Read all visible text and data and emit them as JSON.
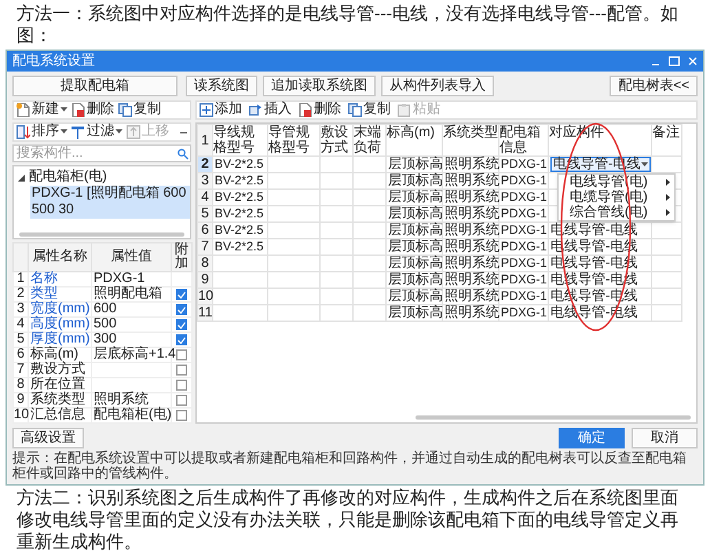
{
  "intro_text": "方法一：系统图中对应构件选择的是电线导管---电线，没有选择电线导管---配管。如图：",
  "dialog": {
    "title": "配电系统设置",
    "top_buttons": [
      "提取配电箱",
      "读系统图",
      "追加读取系统图",
      "从构件列表导入"
    ],
    "tree_table_button": "配电树表<<",
    "left_toolbar_1": [
      {
        "kind": "new",
        "label": "新建",
        "dropdown": true
      },
      {
        "kind": "delete",
        "label": "删除",
        "dropdown": false
      },
      {
        "kind": "copy",
        "label": "复制",
        "dropdown": false
      }
    ],
    "left_toolbar_2": [
      {
        "kind": "sort",
        "label": "排序",
        "dropdown": true,
        "disabled": false
      },
      {
        "kind": "filter",
        "label": "过滤",
        "dropdown": true,
        "disabled": false
      },
      {
        "kind": "up",
        "label": "上移",
        "dropdown": false,
        "disabled": true
      }
    ],
    "search": {
      "placeholder": "搜索构件..."
    },
    "tree": [
      {
        "label": "配电箱柜(电)",
        "expanded": true,
        "selected": false,
        "children": [
          {
            "label": "PDXG-1 [照明配电箱 600 500 30",
            "selected": true
          }
        ]
      }
    ],
    "properties": {
      "columns": [
        "属性名称",
        "属性值",
        "附加"
      ],
      "rows": [
        {
          "no": "1",
          "name": "名称",
          "value": "PDXG-1",
          "required": true
        },
        {
          "no": "2",
          "name": "类型",
          "value": "照明配电箱",
          "required": true,
          "checked": true
        },
        {
          "no": "3",
          "name": "宽度(mm)",
          "value": "600",
          "required": true,
          "checked": true
        },
        {
          "no": "4",
          "name": "高度(mm)",
          "value": "500",
          "required": true,
          "checked": true
        },
        {
          "no": "5",
          "name": "厚度(mm)",
          "value": "300",
          "required": true,
          "checked": true
        },
        {
          "no": "6",
          "name": "标高(m)",
          "value": "层底标高+1.4",
          "required": false,
          "checked": false
        },
        {
          "no": "7",
          "name": "敷设方式",
          "required": false,
          "checked": false
        },
        {
          "no": "8",
          "name": "所在位置",
          "required": false,
          "checked": false
        },
        {
          "no": "9",
          "name": "系统类型",
          "value": "照明系统",
          "required": false,
          "checked": false
        },
        {
          "no": "10",
          "name": "汇总信息",
          "value": "配电箱柜(电)",
          "required": false,
          "checked": false
        }
      ]
    },
    "right_toolbar": [
      {
        "kind": "add",
        "label": "添加",
        "disabled": false
      },
      {
        "kind": "insert",
        "label": "插入",
        "disabled": false
      },
      {
        "kind": "delete",
        "label": "删除",
        "disabled": false
      },
      {
        "kind": "copy",
        "label": "复制",
        "disabled": false
      },
      {
        "kind": "paste",
        "label": "粘贴",
        "disabled": true
      }
    ],
    "table": {
      "header_no": "1",
      "columns": [
        "导线规格型号",
        "导管规格型号",
        "敷设方式",
        "末端负荷",
        "标高(m)",
        "系统类型",
        "配电箱信息",
        "对应构件",
        "备注"
      ],
      "rows": [
        {
          "no": "2",
          "selected": true,
          "wire_spec": "BV-2*2.5",
          "elevation": "层顶标高",
          "system_type": "照明系统",
          "box_info": "PDXG-1",
          "component": "电线导管-电线",
          "editing": true
        },
        {
          "no": "3",
          "selected": false,
          "wire_spec": "BV-2*2.5",
          "elevation": "层顶标高",
          "system_type": "照明系统",
          "box_info": "PDXG-1"
        },
        {
          "no": "4",
          "selected": false,
          "wire_spec": "BV-2*2.5",
          "elevation": "层顶标高",
          "system_type": "照明系统",
          "box_info": "PDXG-1"
        },
        {
          "no": "5",
          "selected": false,
          "wire_spec": "BV-2*2.5",
          "elevation": "层顶标高",
          "system_type": "照明系统",
          "box_info": "PDXG-1"
        },
        {
          "no": "6",
          "selected": false,
          "wire_spec": "BV-2*2.5",
          "elevation": "层顶标高",
          "system_type": "照明系统",
          "box_info": "PDXG-1",
          "component": "电线导管-电线"
        },
        {
          "no": "7",
          "selected": false,
          "wire_spec": "BV-2*2.5",
          "elevation": "层顶标高",
          "system_type": "照明系统",
          "box_info": "PDXG-1",
          "component": "电线导管-电线"
        },
        {
          "no": "8",
          "selected": false,
          "elevation": "层顶标高",
          "system_type": "照明系统",
          "box_info": "PDXG-1",
          "component": "电线导管-电线"
        },
        {
          "no": "9",
          "selected": false,
          "elevation": "层顶标高",
          "system_type": "照明系统",
          "box_info": "PDXG-1",
          "component": "电线导管-电线"
        },
        {
          "no": "10",
          "selected": false,
          "elevation": "层顶标高",
          "system_type": "照明系统",
          "box_info": "PDXG-1",
          "component": "电线导管-电线"
        },
        {
          "no": "11",
          "selected": false,
          "elevation": "层顶标高",
          "system_type": "照明系统",
          "box_info": "PDXG-1",
          "component": "电线导管-电线"
        }
      ],
      "dropdown_menu": [
        {
          "label": "电线导管(电)",
          "has_submenu": true
        },
        {
          "label": "电缆导管(电)",
          "has_submenu": true
        },
        {
          "label": "综合管线(电)",
          "has_submenu": true
        }
      ]
    },
    "advanced_button": "高级设置",
    "ok_button": "确定",
    "cancel_button": "取消",
    "hint": "提示：在配电系统设置中可以提取或者新建配电箱柜和回路构件，并通过自动生成的配电树表可以反查至配电箱柜件或回路中的管线构件。"
  },
  "outro_text": "方法二：识别系统图之后生成构件了再修改的对应构件，生成构件之后在系统图里面修改电线导管里面的定义没有办法关联，只能是删除该配电箱下面的电线导管定义再重新生成构件。"
}
